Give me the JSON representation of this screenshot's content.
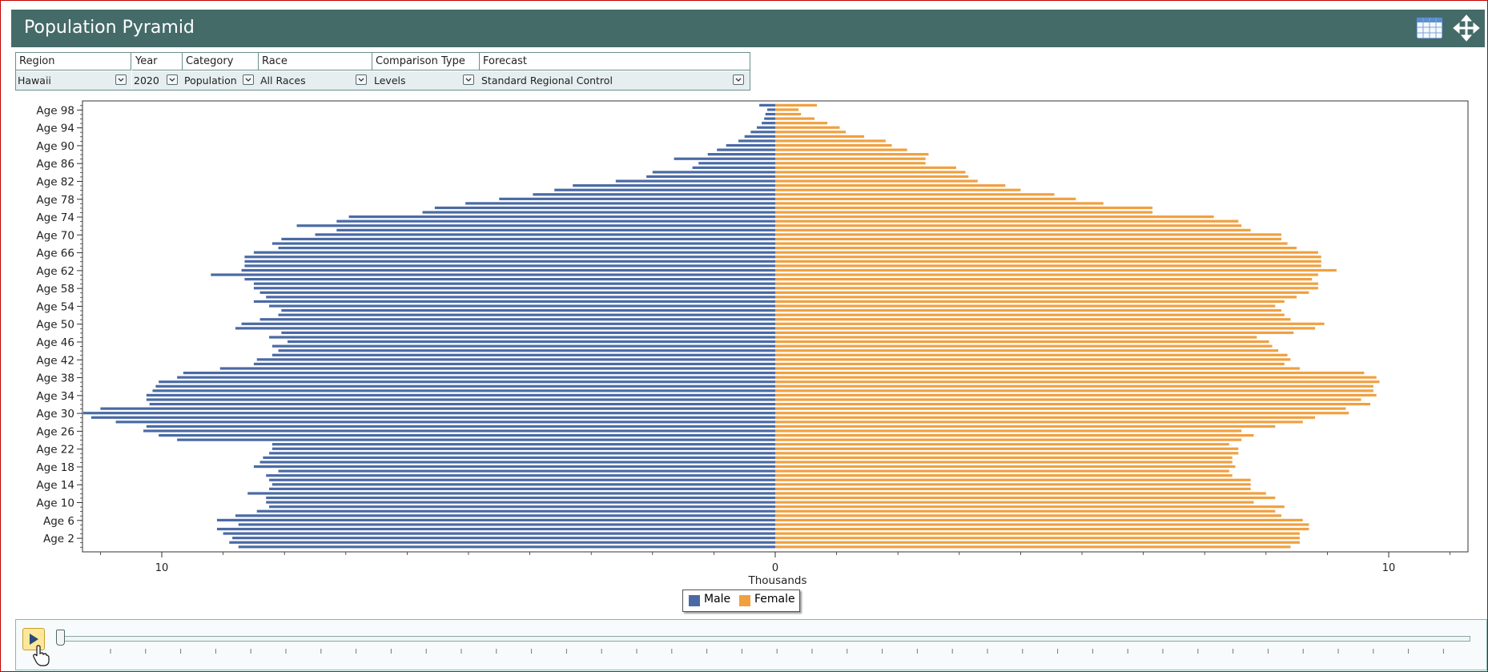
{
  "window": {
    "title": "Population Pyramid"
  },
  "header_icons": {
    "table": "table-grid-icon",
    "move": "move-arrows-icon"
  },
  "filters": {
    "region": {
      "label": "Region",
      "value": "Hawaii"
    },
    "year": {
      "label": "Year",
      "value": "2020"
    },
    "category": {
      "label": "Category",
      "value": "Population"
    },
    "race": {
      "label": "Race",
      "value": "All Races"
    },
    "comparison": {
      "label": "Comparison Type",
      "value": "Levels"
    },
    "forecast": {
      "label": "Forecast",
      "value": "Standard Regional Control"
    }
  },
  "colors": {
    "header": "#456b69",
    "male": "#4a6aa5",
    "female": "#f0a040"
  },
  "legend": {
    "male": "Male",
    "female": "Female"
  },
  "player": {
    "play_icon": "play-icon",
    "tick_count": 40
  },
  "chart_data": {
    "type": "bar",
    "orientation": "horizontal-pyramid",
    "xlabel": "Thousands",
    "xlim": [
      -11.3,
      11.3
    ],
    "xtick_labels": [
      "10",
      "0",
      "10"
    ],
    "xtick_values": [
      -10,
      0,
      10
    ],
    "ytick_labels": [
      "Age 2",
      "Age 6",
      "Age 10",
      "Age 14",
      "Age 18",
      "Age 22",
      "Age 26",
      "Age 30",
      "Age 34",
      "Age 38",
      "Age 42",
      "Age 46",
      "Age 50",
      "Age 54",
      "Age 58",
      "Age 62",
      "Age 66",
      "Age 70",
      "Age 74",
      "Age 78",
      "Age 82",
      "Age 86",
      "Age 90",
      "Age 94",
      "Age 98"
    ],
    "categories": [
      "0",
      "1",
      "2",
      "3",
      "4",
      "5",
      "6",
      "7",
      "8",
      "9",
      "10",
      "11",
      "12",
      "13",
      "14",
      "15",
      "16",
      "17",
      "18",
      "19",
      "20",
      "21",
      "22",
      "23",
      "24",
      "25",
      "26",
      "27",
      "28",
      "29",
      "30",
      "31",
      "32",
      "33",
      "34",
      "35",
      "36",
      "37",
      "38",
      "39",
      "40",
      "41",
      "42",
      "43",
      "44",
      "45",
      "46",
      "47",
      "48",
      "49",
      "50",
      "51",
      "52",
      "53",
      "54",
      "55",
      "56",
      "57",
      "58",
      "59",
      "60",
      "61",
      "62",
      "63",
      "64",
      "65",
      "66",
      "67",
      "68",
      "69",
      "70",
      "71",
      "72",
      "73",
      "74",
      "75",
      "76",
      "77",
      "78",
      "79",
      "80",
      "81",
      "82",
      "83",
      "84",
      "85",
      "86",
      "87",
      "88",
      "89",
      "90",
      "91",
      "92",
      "93",
      "94",
      "95",
      "96",
      "97",
      "98",
      "99"
    ],
    "series": [
      {
        "name": "Male",
        "values": [
          8.75,
          8.9,
          8.85,
          9.0,
          9.1,
          8.75,
          9.1,
          8.8,
          8.45,
          8.25,
          8.3,
          8.3,
          8.6,
          8.25,
          8.2,
          8.25,
          8.3,
          8.1,
          8.5,
          8.4,
          8.35,
          8.25,
          8.2,
          8.2,
          9.75,
          10.05,
          10.3,
          10.25,
          10.75,
          11.15,
          11.28,
          11.0,
          10.2,
          10.25,
          10.25,
          10.15,
          10.1,
          10.05,
          9.75,
          9.65,
          9.05,
          8.5,
          8.45,
          8.2,
          8.1,
          8.2,
          7.95,
          8.25,
          8.05,
          8.8,
          8.7,
          8.4,
          8.1,
          8.05,
          8.25,
          8.5,
          8.3,
          8.4,
          8.5,
          8.5,
          8.65,
          9.2,
          8.7,
          8.65,
          8.65,
          8.65,
          8.5,
          8.1,
          8.2,
          8.05,
          7.5,
          7.15,
          7.8,
          7.15,
          6.95,
          5.75,
          5.55,
          5.05,
          4.5,
          3.95,
          3.6,
          3.3,
          2.6,
          2.1,
          2.0,
          1.35,
          1.25,
          1.65,
          1.1,
          0.95,
          0.8,
          0.6,
          0.5,
          0.4,
          0.3,
          0.22,
          0.18,
          0.16,
          0.13,
          0.26
        ]
      },
      {
        "name": "Female",
        "values": [
          8.4,
          8.55,
          8.55,
          8.55,
          8.7,
          8.7,
          8.6,
          8.25,
          8.15,
          8.3,
          7.8,
          8.15,
          8.0,
          7.75,
          7.75,
          7.75,
          7.45,
          7.4,
          7.5,
          7.45,
          7.45,
          7.55,
          7.55,
          7.4,
          7.6,
          7.8,
          7.6,
          8.15,
          8.6,
          8.8,
          9.35,
          9.3,
          9.7,
          9.55,
          9.8,
          9.75,
          9.75,
          9.85,
          9.8,
          9.6,
          8.55,
          8.3,
          8.4,
          8.35,
          8.2,
          8.1,
          8.05,
          7.85,
          8.45,
          8.8,
          8.95,
          8.4,
          8.3,
          8.25,
          8.15,
          8.3,
          8.5,
          8.7,
          8.85,
          8.85,
          8.75,
          8.85,
          9.15,
          8.9,
          8.9,
          8.9,
          8.85,
          8.5,
          8.35,
          8.25,
          8.25,
          7.75,
          7.6,
          7.55,
          7.15,
          6.15,
          6.15,
          5.35,
          4.9,
          4.55,
          4.0,
          3.75,
          3.3,
          3.15,
          3.1,
          2.95,
          2.45,
          2.45,
          2.5,
          2.15,
          1.9,
          1.8,
          1.45,
          1.15,
          1.05,
          0.85,
          0.64,
          0.42,
          0.38,
          0.68
        ]
      }
    ],
    "legend": "bottom-center",
    "grid": false
  }
}
